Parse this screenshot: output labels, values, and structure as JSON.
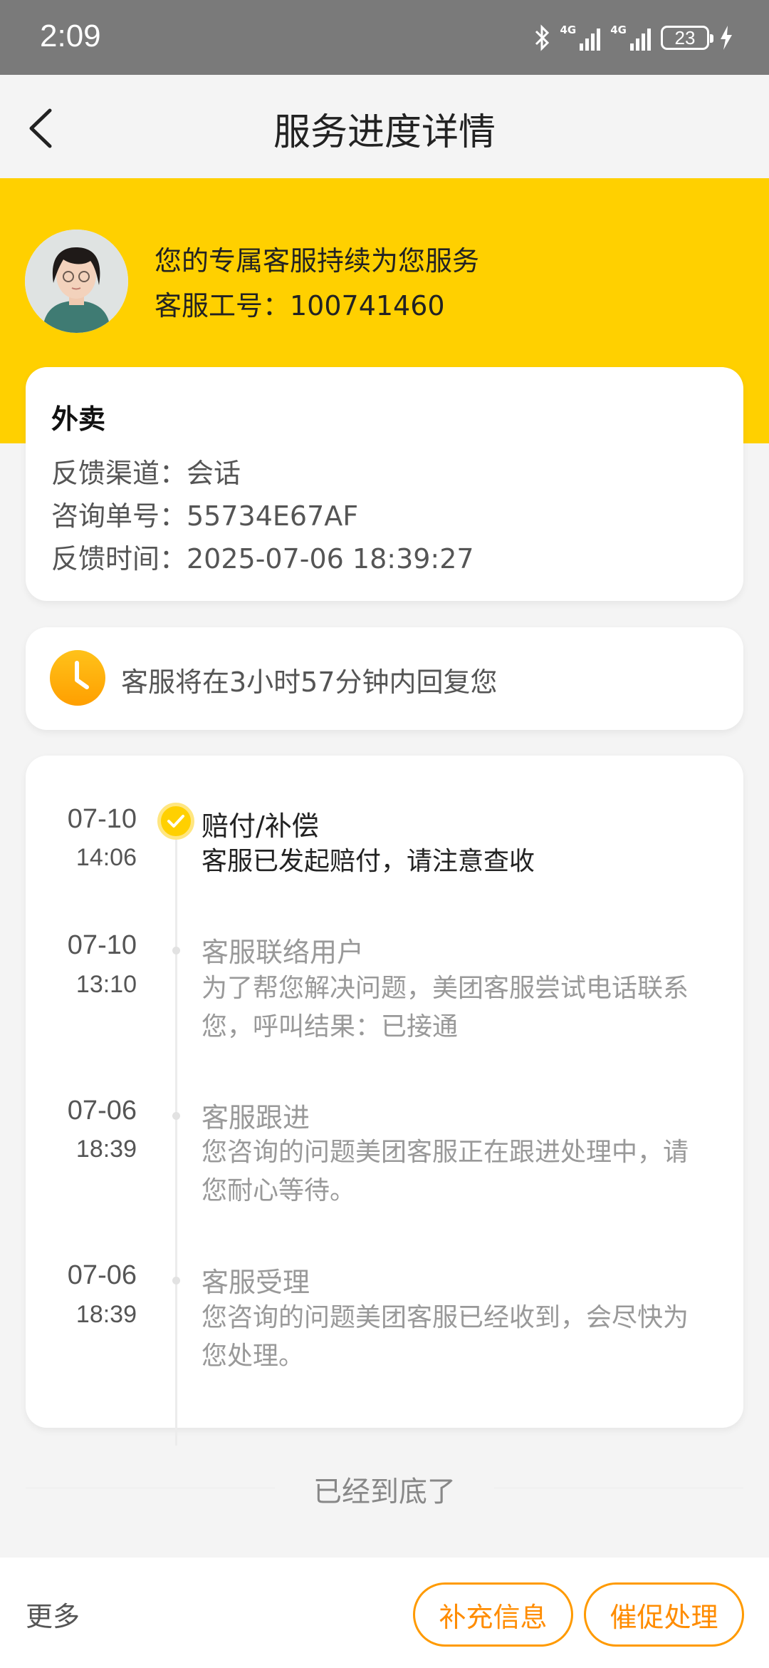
{
  "status_bar": {
    "time": "2:09",
    "network_1": "4G",
    "network_2": "4G",
    "battery": "23"
  },
  "header": {
    "title": "服务进度详情"
  },
  "agent": {
    "title": "您的专属客服持续为您服务",
    "id_text": "客服工号：100741460"
  },
  "info": {
    "business_type": "外卖",
    "channel": "反馈渠道：会话",
    "order_no": "咨询单号：55734E67AF",
    "time": "反馈时间：2025-07-06 18:39:27"
  },
  "reply": {
    "text": "客服将在3小时57分钟内回复您"
  },
  "timeline": [
    {
      "date": "07-10",
      "time": "14:06",
      "title": "赔付/补偿",
      "desc": "客服已发起赔付，请注意查收",
      "active": true
    },
    {
      "date": "07-10",
      "time": "13:10",
      "title": "客服联络用户",
      "desc": "为了帮您解决问题，美团客服尝试电话联系您，呼叫结果：已接通",
      "active": false
    },
    {
      "date": "07-06",
      "time": "18:39",
      "title": "客服跟进",
      "desc": "您咨询的问题美团客服正在跟进处理中，请您耐心等待。",
      "active": false
    },
    {
      "date": "07-06",
      "time": "18:39",
      "title": "客服受理",
      "desc": "您咨询的问题美团客服已经收到，会尽快为您处理。",
      "active": false
    }
  ],
  "footer_note": "已经到底了",
  "bottom_bar": {
    "more": "更多",
    "supplement": "补充信息",
    "urge": "催促处理"
  },
  "colors": {
    "accent": "#ffd000",
    "button": "#ff8c00"
  }
}
